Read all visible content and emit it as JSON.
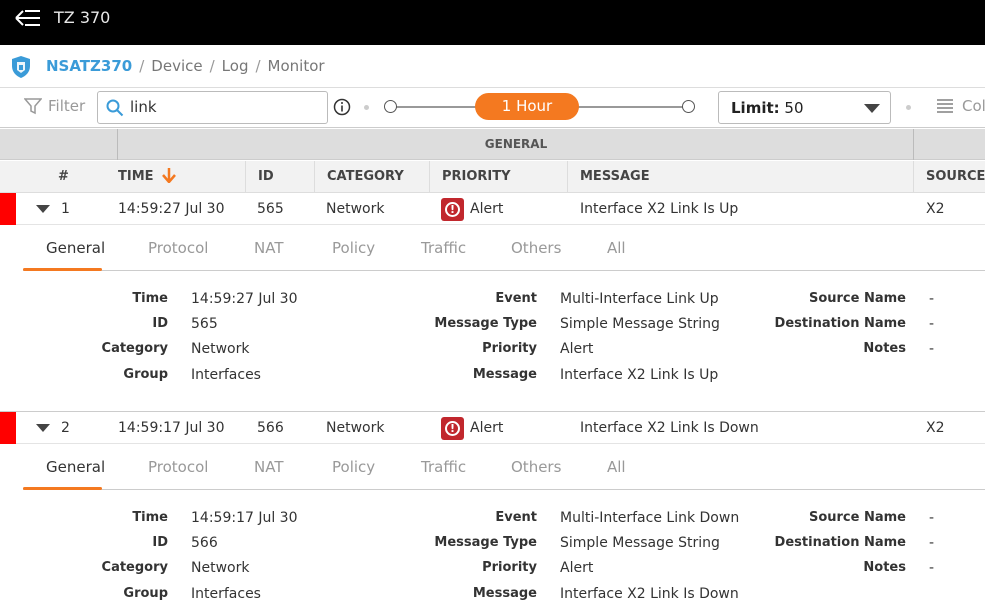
{
  "app": {
    "title": "TZ 370"
  },
  "breadcrumb": {
    "device": "NSATZ370",
    "items": [
      "Device",
      "Log",
      "Monitor"
    ],
    "separator": "/"
  },
  "filterbar": {
    "filter_label": "Filter",
    "search_value": "link",
    "time_range": "1 Hour",
    "limit_label": "Limit:",
    "limit_value": "50",
    "columns_label": "Columns"
  },
  "table": {
    "group_header": "GENERAL",
    "columns": [
      "#",
      "TIME",
      "ID",
      "CATEGORY",
      "PRIORITY",
      "MESSAGE",
      "SOURCE"
    ]
  },
  "detail_tabs": [
    "General",
    "Protocol",
    "NAT",
    "Policy",
    "Traffic",
    "Others",
    "All"
  ],
  "detail_labels": {
    "time": "Time",
    "id": "ID",
    "category": "Category",
    "group": "Group",
    "event": "Event",
    "message_type": "Message Type",
    "priority": "Priority",
    "message": "Message",
    "source_name": "Source Name",
    "destination_name": "Destination Name",
    "notes": "Notes"
  },
  "rows": [
    {
      "num": "1",
      "time": "14:59:27 Jul 30",
      "id": "565",
      "category": "Network",
      "priority": "Alert",
      "message": "Interface X2 Link Is Up",
      "source": "X2",
      "detail": {
        "time": "14:59:27 Jul 30",
        "id": "565",
        "category": "Network",
        "group": "Interfaces",
        "event": "Multi-Interface Link Up",
        "message_type": "Simple Message String",
        "priority": "Alert",
        "message": "Interface X2 Link Is Up",
        "source_name": "-",
        "destination_name": "-",
        "notes": "-"
      }
    },
    {
      "num": "2",
      "time": "14:59:17 Jul 30",
      "id": "566",
      "category": "Network",
      "priority": "Alert",
      "message": "Interface X2 Link Is Down",
      "source": "X2",
      "detail": {
        "time": "14:59:17 Jul 30",
        "id": "566",
        "category": "Network",
        "group": "Interfaces",
        "event": "Multi-Interface Link Down",
        "message_type": "Simple Message String",
        "priority": "Alert",
        "message": "Interface X2 Link Is Down",
        "source_name": "-",
        "destination_name": "-",
        "notes": "-"
      }
    }
  ],
  "colors": {
    "accent": "#f47920",
    "brand": "#3a9bd8",
    "alert": "#c1272d",
    "row_marker": "#ff0000"
  },
  "icons": [
    "menu-back-icon",
    "shield-icon",
    "filter-funnel-icon",
    "search-icon",
    "info-icon",
    "chevron-down-icon",
    "columns-list-icon",
    "caret-down-icon",
    "alert-icon"
  ]
}
